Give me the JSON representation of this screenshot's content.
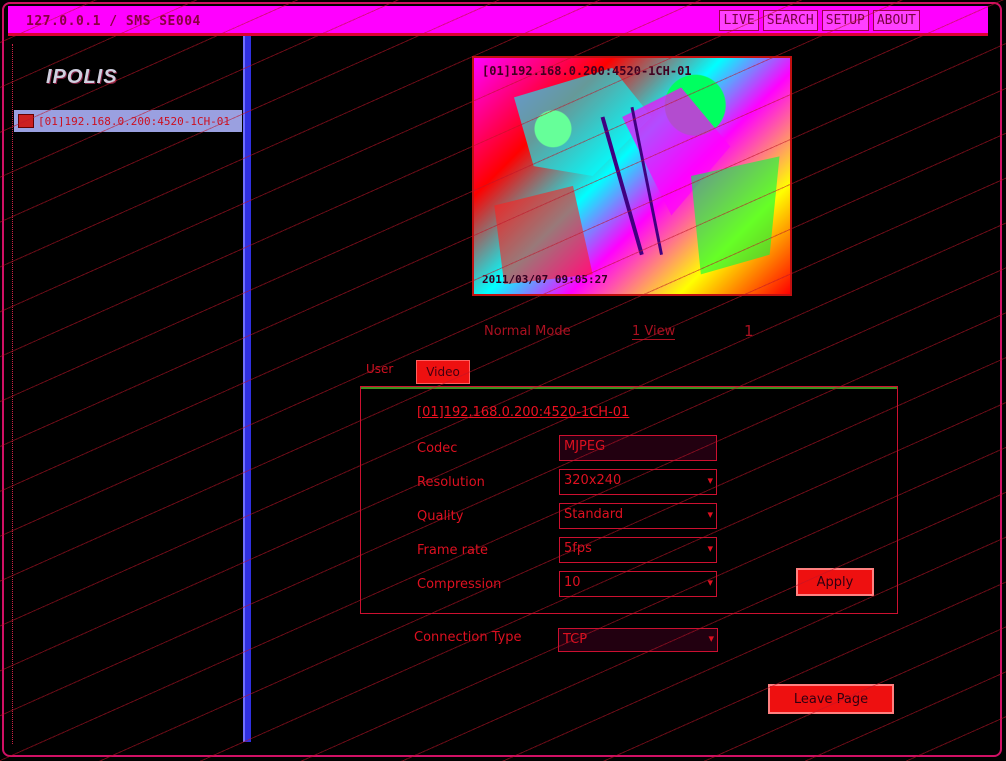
{
  "header": {
    "title": "127.0.0.1 / SMS SE004",
    "nav": [
      "LIVE",
      "SEARCH",
      "SETUP",
      "ABOUT"
    ]
  },
  "sidebar": {
    "logo": "IPOLIS",
    "camera_item": "[01]192.168.0.200:4520-1CH-01"
  },
  "video": {
    "overlay_title": "[01]192.168.0.200:4520-1CH-01",
    "timestamp": "2011/03/07 09:05:27"
  },
  "controls": {
    "mode_label": "Normal Mode",
    "layout_value": "1 View",
    "extra_value": "1"
  },
  "tabs": {
    "user": "User",
    "video": "Video"
  },
  "panel": {
    "device_info": "[01]192.168.0.200:4520-1CH-01",
    "rows": [
      {
        "label": "Codec",
        "value": "MJPEG"
      },
      {
        "label": "Resolution",
        "value": "320x240"
      },
      {
        "label": "Quality",
        "value": "Standard"
      },
      {
        "label": "Frame rate",
        "value": "5fps"
      },
      {
        "label": "Compression",
        "value": "10"
      }
    ],
    "apply": "Apply"
  },
  "connection": {
    "label": "Connection Type",
    "value": "TCP"
  },
  "leave_button": "Leave Page"
}
